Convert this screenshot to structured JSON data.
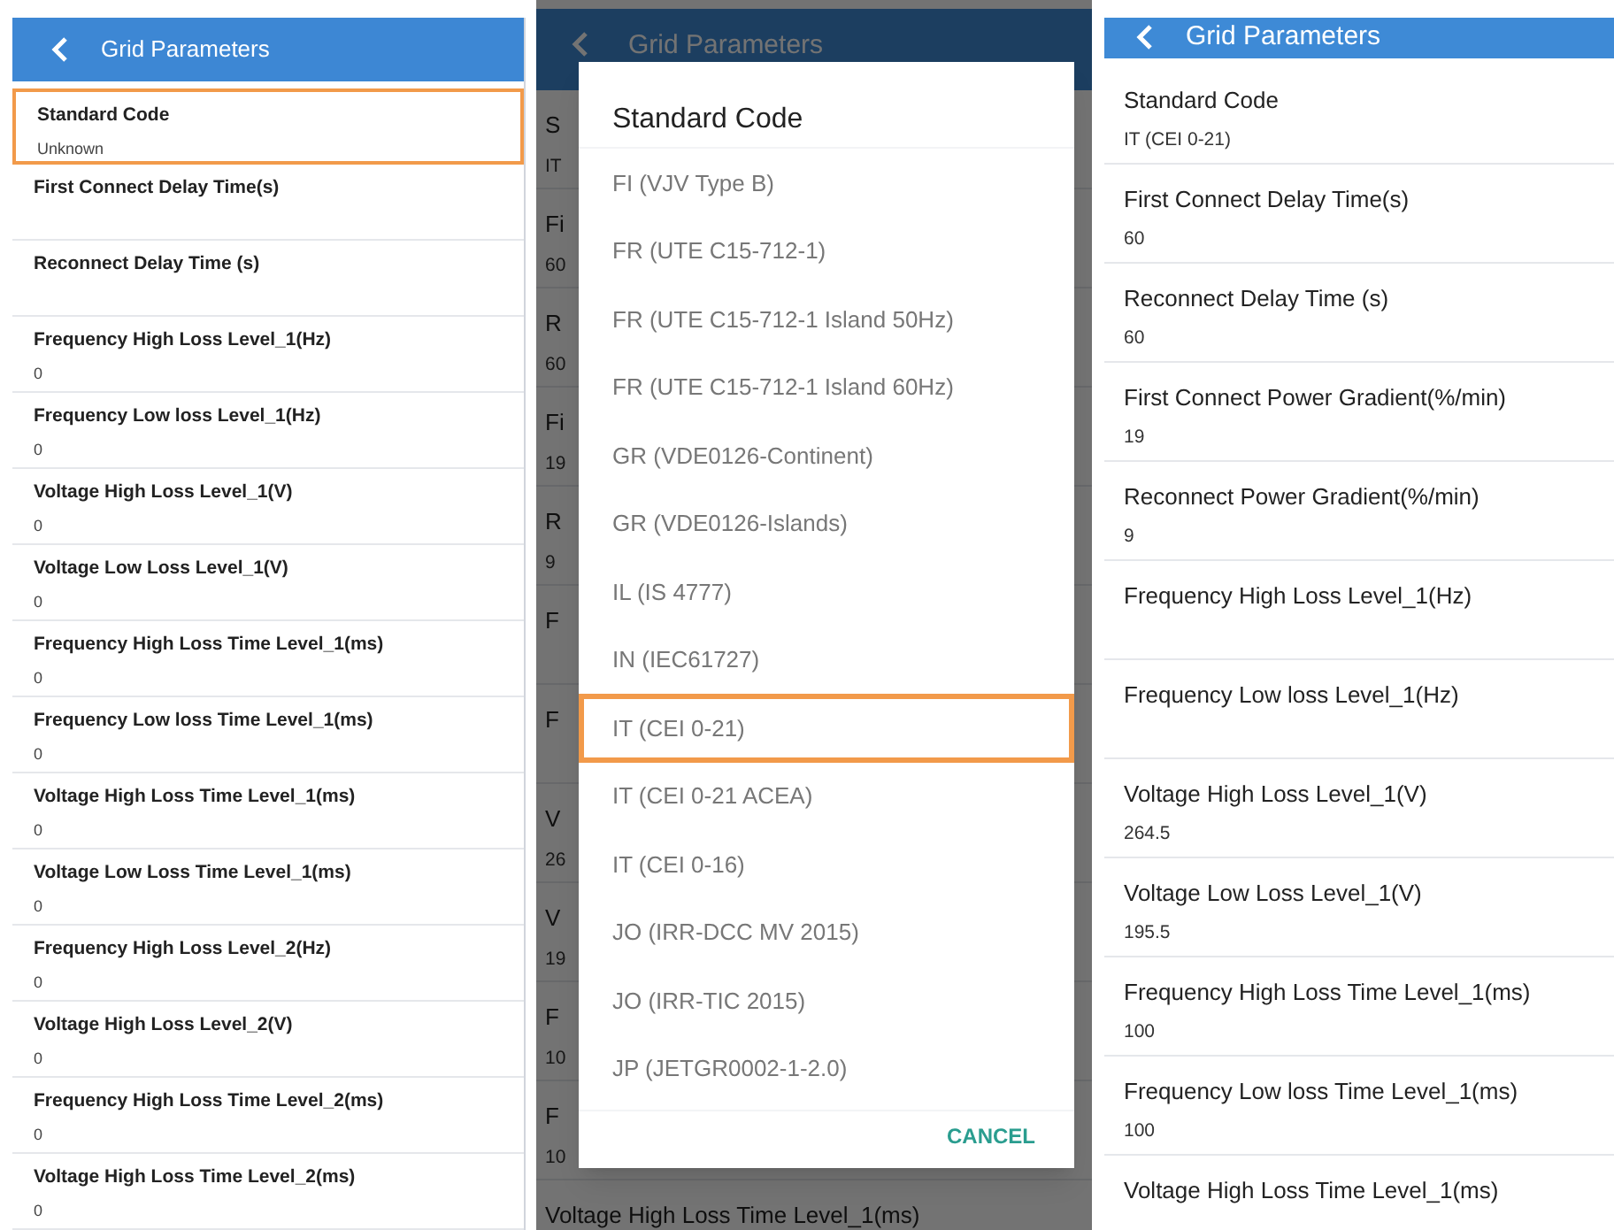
{
  "panels": [
    {
      "kind": "list",
      "title": "Grid Parameters",
      "rows": [
        {
          "label": "Standard Code",
          "value": "Unknown",
          "selected": true
        },
        {
          "label": "First Connect Delay Time(s)",
          "selected": false
        },
        {
          "label": "Reconnect Delay Time (s)",
          "selected": false
        },
        {
          "label": "Frequency High Loss Level_1(Hz)",
          "value": "0",
          "selected": false
        },
        {
          "label": "Frequency Low loss Level_1(Hz)",
          "value": "0",
          "selected": false
        },
        {
          "label": "Voltage High Loss Level_1(V)",
          "value": "0",
          "selected": false
        },
        {
          "label": "Voltage Low Loss Level_1(V)",
          "value": "0",
          "selected": false
        },
        {
          "label": "Frequency High Loss Time Level_1(ms)",
          "value": "0",
          "selected": false
        },
        {
          "label": "Frequency Low loss Time Level_1(ms)",
          "value": "0",
          "selected": false
        },
        {
          "label": "Voltage High Loss Time Level_1(ms)",
          "value": "0",
          "selected": false
        },
        {
          "label": "Voltage Low Loss Time Level_1(ms)",
          "value": "0",
          "selected": false
        },
        {
          "label": "Frequency High Loss Level_2(Hz)",
          "value": "0",
          "selected": false
        },
        {
          "label": "Voltage High Loss Level_2(V)",
          "value": "0",
          "selected": false
        },
        {
          "label": "Frequency High Loss Time Level_2(ms)",
          "value": "0",
          "selected": false
        },
        {
          "label": "Voltage High Loss Time Level_2(ms)",
          "value": "0",
          "selected": false
        }
      ]
    },
    {
      "kind": "dialog",
      "title": "Grid Parameters",
      "rows": [
        {
          "label": "S",
          "value": "IT"
        },
        {
          "label": "Fi",
          "value": "60"
        },
        {
          "label": "R",
          "value": "60"
        },
        {
          "label": "Fi",
          "value": "19"
        },
        {
          "label": "R",
          "value": "9"
        },
        {
          "label": "F"
        },
        {
          "label": "F"
        },
        {
          "label": "V",
          "value": "26"
        },
        {
          "label": "V",
          "value": "19"
        },
        {
          "label": "F",
          "value": "10"
        },
        {
          "label": "F",
          "value": "10"
        },
        {
          "label": "Voltage High Loss Time Level_1(ms)"
        }
      ],
      "dialog": {
        "title": "Standard Code",
        "cancel": "CANCEL",
        "options": [
          {
            "label": "FI (VJV Type B)",
            "selected": false
          },
          {
            "label": "FR (UTE C15-712-1)",
            "selected": false
          },
          {
            "label": "FR (UTE C15-712-1 Island 50Hz)",
            "selected": false
          },
          {
            "label": "FR (UTE C15-712-1 Island 60Hz)",
            "selected": false
          },
          {
            "label": "GR (VDE0126-Continent)",
            "selected": false
          },
          {
            "label": "GR (VDE0126-Islands)",
            "selected": false
          },
          {
            "label": "IL (IS 4777)",
            "selected": false
          },
          {
            "label": "IN (IEC61727)",
            "selected": false
          },
          {
            "label": "IT (CEI 0-21)",
            "selected": true
          },
          {
            "label": "IT (CEI 0-21 ACEA)",
            "selected": false
          },
          {
            "label": "IT (CEI 0-16)",
            "selected": false
          },
          {
            "label": "JO (IRR-DCC MV 2015)",
            "selected": false
          },
          {
            "label": "JO (IRR-TIC 2015)",
            "selected": false
          },
          {
            "label": "JP (JETGR0002-1-2.0)",
            "selected": false
          }
        ]
      }
    },
    {
      "kind": "list",
      "title": "Grid Parameters",
      "rows": [
        {
          "label": "Standard Code",
          "value": "IT (CEI 0-21)",
          "selected": false
        },
        {
          "label": "First Connect Delay Time(s)",
          "value": "60",
          "selected": false
        },
        {
          "label": "Reconnect Delay Time (s)",
          "value": "60",
          "selected": false
        },
        {
          "label": "First Connect Power Gradient(%/min)",
          "value": "19",
          "selected": false
        },
        {
          "label": "Reconnect Power Gradient(%/min)",
          "value": "9",
          "selected": false
        },
        {
          "label": "Frequency High Loss Level_1(Hz)",
          "selected": false
        },
        {
          "label": "Frequency Low loss Level_1(Hz)",
          "selected": false
        },
        {
          "label": "Voltage High Loss Level_1(V)",
          "value": "264.5",
          "selected": false
        },
        {
          "label": "Voltage Low Loss Level_1(V)",
          "value": "195.5",
          "selected": false
        },
        {
          "label": "Frequency High Loss Time Level_1(ms)",
          "value": "100",
          "selected": false
        },
        {
          "label": "Frequency Low loss Time Level_1(ms)",
          "value": "100",
          "selected": false
        },
        {
          "label": "Voltage High Loss Time Level_1(ms)",
          "selected": false
        }
      ]
    }
  ]
}
